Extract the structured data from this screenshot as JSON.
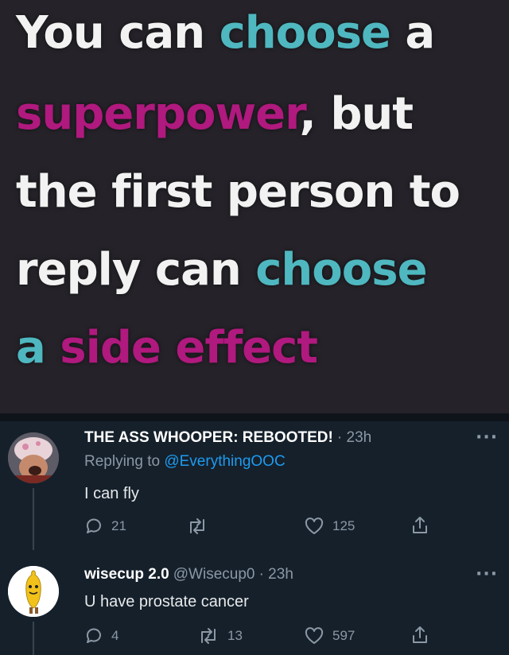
{
  "meme": {
    "line1": {
      "a": "You can ",
      "b": "choose",
      "c": " a"
    },
    "line2": {
      "a": "superpower",
      "b": ", but"
    },
    "line3": {
      "a": "the first person to"
    },
    "line4": {
      "a": "reply can ",
      "b": "choose"
    },
    "line5": {
      "a": "a",
      "b": " side effect"
    }
  },
  "tweets": [
    {
      "name": "THE ASS WHOOPER: REBOOTED!",
      "time": "· 23h",
      "replying_prefix": "Replying to ",
      "replying_handle": "@EverythingOOC",
      "text": "I can fly",
      "replies": "21",
      "retweets": "",
      "likes": "125"
    },
    {
      "name": "wisecup 2.0",
      "handle": "@Wisecup0",
      "time": "· 23h",
      "text": "U have prostate cancer",
      "replies": "4",
      "retweets": "13",
      "likes": "597"
    }
  ],
  "more_label": "···",
  "colors": {
    "teal": "#4fb7c0",
    "magenta": "#b0197e",
    "background": "#15202b",
    "link": "#1d9bf0"
  }
}
